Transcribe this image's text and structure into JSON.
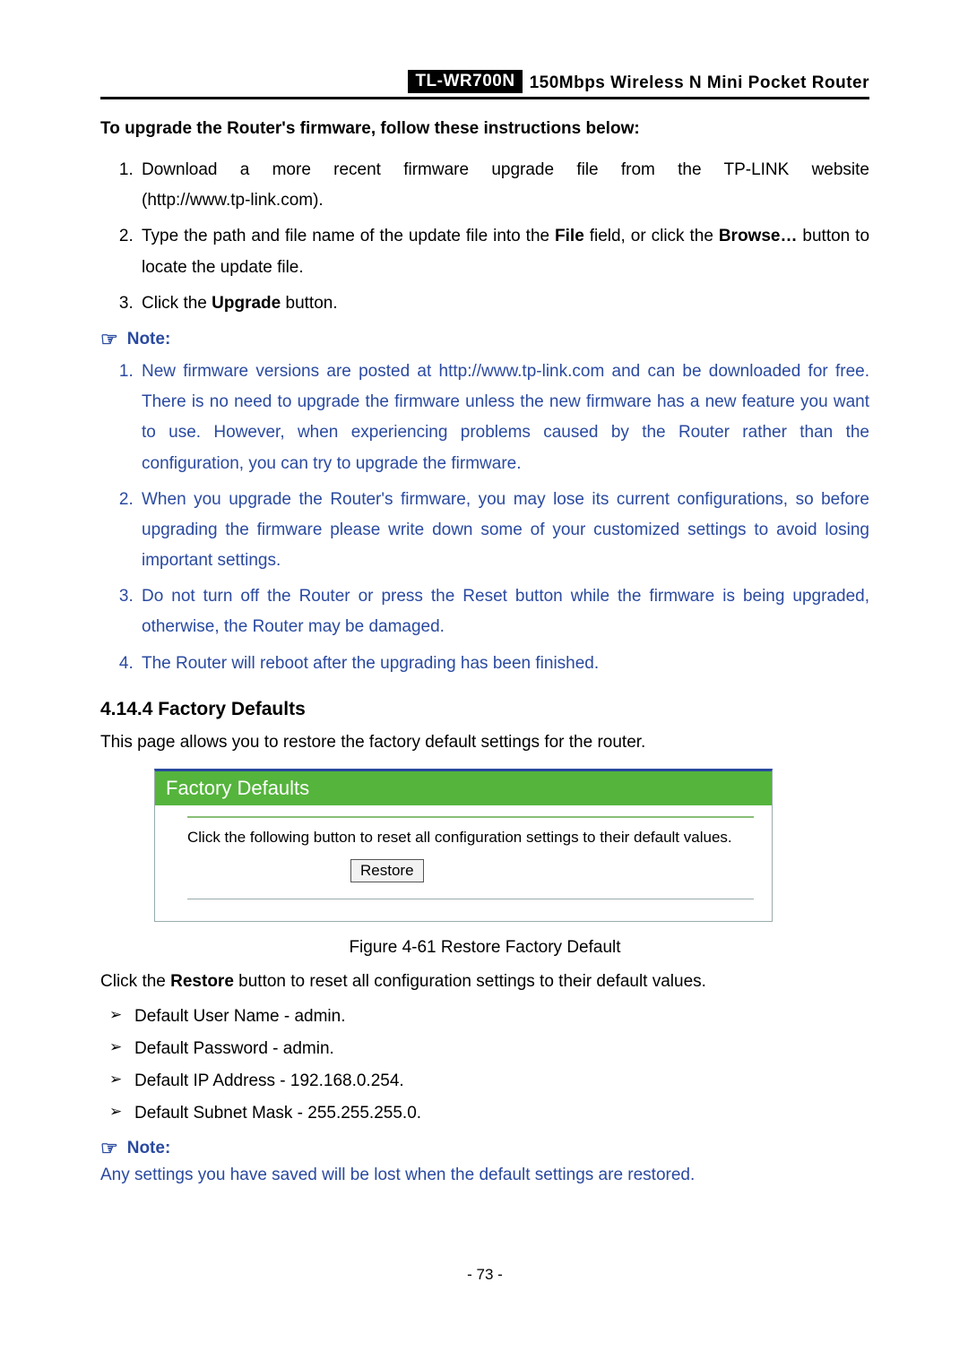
{
  "header": {
    "model": "TL-WR700N",
    "desc": "150Mbps  Wireless  N  Mini  Pocket  Router"
  },
  "intro_bold": "To upgrade the Router's firmware, follow these instructions below:",
  "steps1": {
    "s1a": "Download   a   more   recent   firmware   upgrade   file   from   the   TP-LINK   website",
    "s1b": "(http://www.tp-link.com).",
    "s2a": "Type the path and file name of the update file into the ",
    "s2_file": "File",
    "s2b": " field, or click the ",
    "s2_browse": "Browse…",
    "s2c": " button to locate the update file.",
    "s3a": "Click the ",
    "s3_upgrade": "Upgrade",
    "s3b": " button."
  },
  "note_label": "Note:",
  "notes1": {
    "n1": "New firmware versions are posted at http://www.tp-link.com and can be downloaded for free. There is no need to upgrade the firmware unless the new firmware has a new feature you want to use. However, when experiencing problems caused by the Router rather than the configuration, you can try to upgrade the firmware.",
    "n2": "When you upgrade the Router's firmware, you may lose its current configurations, so before upgrading the firmware please write down some of your customized settings to avoid losing important settings.",
    "n3": "Do not turn off the Router or press the Reset button while the firmware is being upgraded, otherwise, the Router may be damaged.",
    "n4": "The Router will reboot after the upgrading has been finished."
  },
  "h4": "4.14.4 Factory Defaults",
  "fd_intro": "This page allows you to restore the factory default settings for the router.",
  "ui": {
    "title": "Factory Defaults",
    "text": "Click the following button to reset all configuration settings to their default values.",
    "button": "Restore"
  },
  "caption": "Figure 4-61 Restore Factory Default",
  "restore_a": "Click the ",
  "restore_bold": "Restore",
  "restore_b": " button to reset all configuration settings to their default values.",
  "defaults": {
    "d1": "Default User Name - admin.",
    "d2": "Default Password - admin.",
    "d3": "Default IP Address - 192.168.0.254.",
    "d4": "Default Subnet Mask - 255.255.255.0."
  },
  "note2_text": "Any settings you have saved will be lost when the default settings are restored.",
  "page_num": "- 73 -"
}
